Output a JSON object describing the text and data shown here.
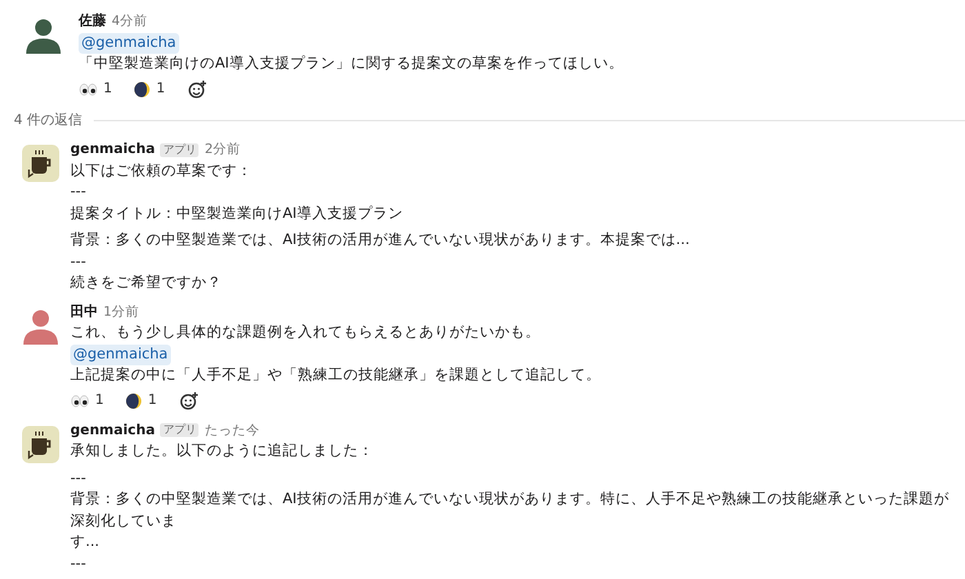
{
  "parent": {
    "author": "佐藤",
    "time": "4分前",
    "avatar": {
      "kind": "person",
      "color": "#3e5c47"
    },
    "blocks": [
      {
        "kind": "mention",
        "text": "@genmaicha"
      },
      {
        "kind": "line",
        "text": "「中堅製造業向けのAI導入支援プラン」に関する提案文の草案を作ってほしい。"
      }
    ],
    "reactions": [
      {
        "kind": "eyes",
        "count": "1"
      },
      {
        "kind": "moon",
        "count": "1"
      }
    ]
  },
  "reply_count": "4 件の返信",
  "replies": [
    {
      "author": "genmaicha",
      "badge": "アプリ",
      "time": "2分前",
      "avatar": {
        "kind": "app"
      },
      "blocks": [
        {
          "kind": "line",
          "text": "以下はご依頼の草案です："
        },
        {
          "kind": "line",
          "text": "---"
        },
        {
          "kind": "line",
          "text": "提案タイトル：中堅製造業向けAI導入支援プラン"
        },
        {
          "kind": "paragraph",
          "text": "背景：多くの中堅製造業では、AI技術の活用が進んでいない現状があります。本提案では..."
        },
        {
          "kind": "line",
          "text": "---"
        },
        {
          "kind": "line",
          "text": "続きをご希望ですか？"
        }
      ]
    },
    {
      "author": "田中",
      "time": "1分前",
      "avatar": {
        "kind": "person",
        "color": "#d37474"
      },
      "blocks": [
        {
          "kind": "line",
          "text": "これ、もう少し具体的な課題例を入れてもらえるとありがたいかも。"
        },
        {
          "kind": "mention",
          "text": "@genmaicha"
        },
        {
          "kind": "line",
          "text": "上記提案の中に「人手不足」や「熟練工の技能継承」を課題として追記して。"
        }
      ],
      "reactions": [
        {
          "kind": "eyes",
          "count": "1"
        },
        {
          "kind": "moon",
          "count": "1"
        }
      ]
    },
    {
      "author": "genmaicha",
      "badge": "アプリ",
      "time": "たった今",
      "avatar": {
        "kind": "app"
      },
      "blocks": [
        {
          "kind": "line",
          "text": "承知しました。以下のように追記しました："
        },
        {
          "kind": "paragraph",
          "text": "---"
        },
        {
          "kind": "line",
          "text": "背景：多くの中堅製造業では、AI技術の活用が進んでいない現状があります。特に、人手不足や熟練工の技能継承といった課題が深刻化していま"
        },
        {
          "kind": "line",
          "text": "す..."
        },
        {
          "kind": "line",
          "text": "---"
        }
      ]
    }
  ]
}
